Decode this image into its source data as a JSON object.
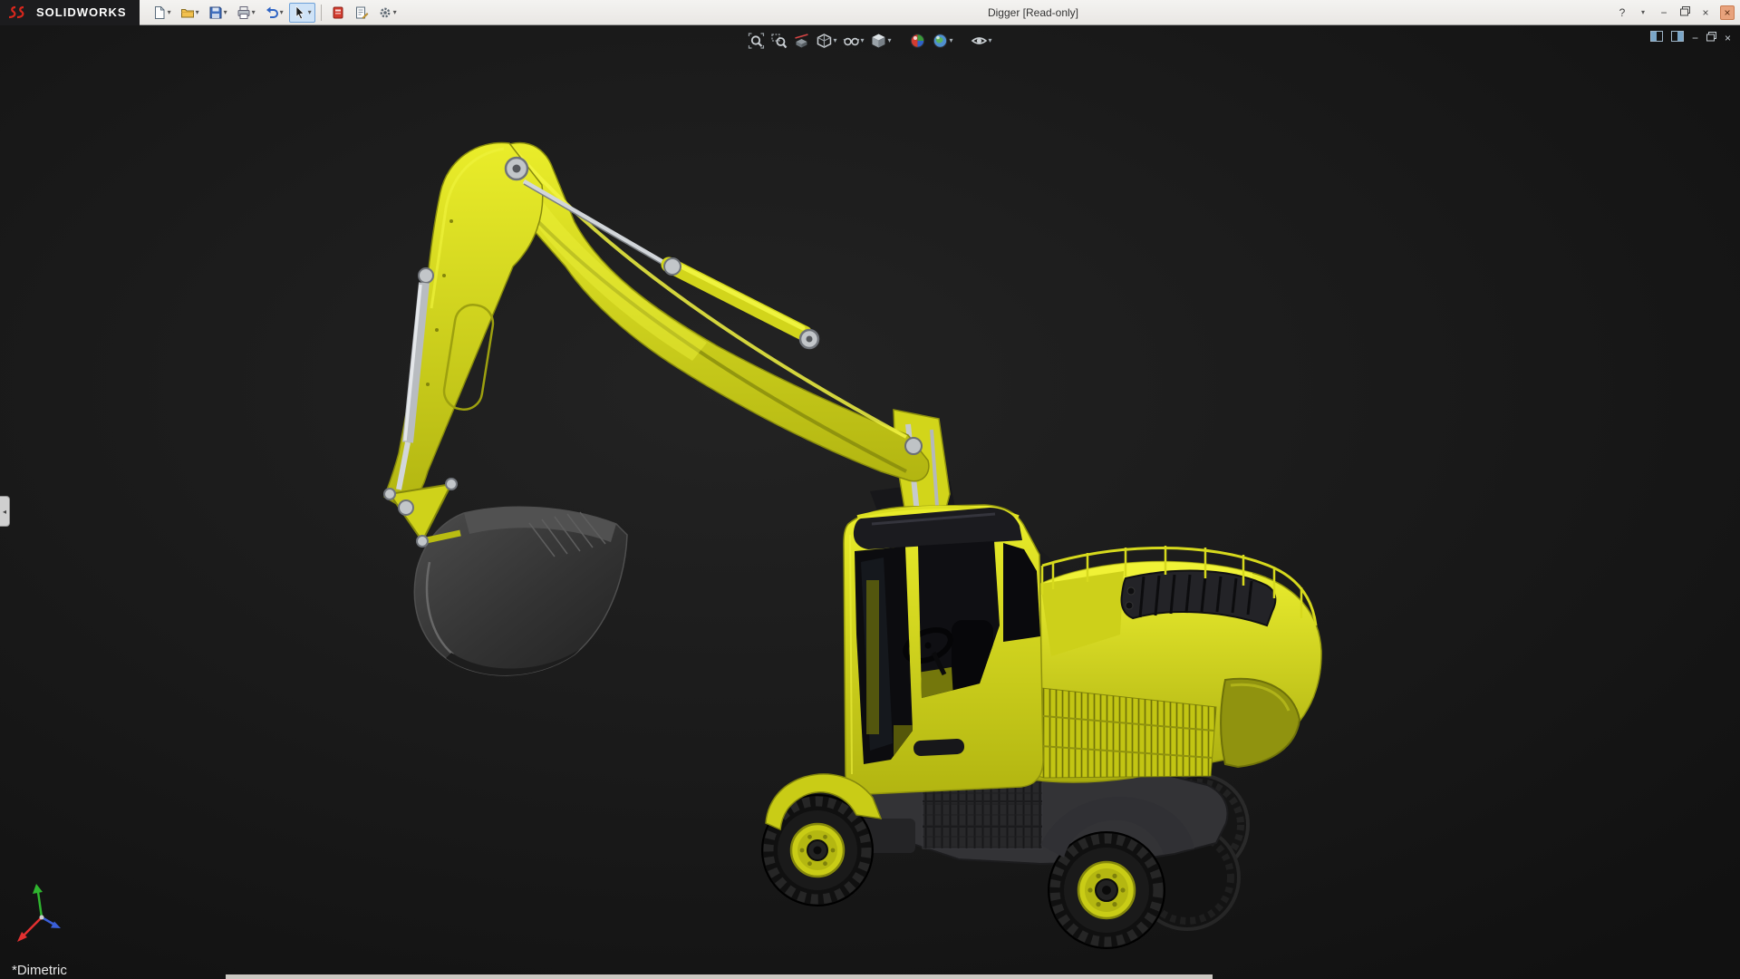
{
  "window": {
    "brand": "SOLIDWORKS",
    "title": "Digger [Read-only]"
  },
  "title_bar": {
    "tools": [
      {
        "name": "new",
        "dropdown": true
      },
      {
        "name": "open",
        "dropdown": true
      },
      {
        "name": "save",
        "dropdown": true
      },
      {
        "name": "print",
        "dropdown": true
      },
      {
        "name": "undo",
        "dropdown": true
      },
      {
        "name": "select",
        "dropdown": true,
        "active": true
      },
      {
        "name": "xpress-products",
        "dropdown": false
      },
      {
        "name": "file-properties",
        "dropdown": false
      },
      {
        "name": "options",
        "dropdown": true
      }
    ],
    "window_controls": [
      "help",
      "menu-caret",
      "minimize",
      "restore",
      "close",
      "app-close"
    ]
  },
  "headsup_toolbar": {
    "items": [
      {
        "name": "zoom-to-fit",
        "dropdown": false
      },
      {
        "name": "zoom-to-area",
        "dropdown": false
      },
      {
        "name": "section-view",
        "dropdown": false
      },
      {
        "name": "display-style",
        "dropdown": true
      },
      {
        "name": "hide-show-items",
        "dropdown": true
      },
      {
        "name": "view-orientation",
        "dropdown": true
      },
      {
        "name": "edit-appearance",
        "dropdown": false
      },
      {
        "name": "apply-scene",
        "dropdown": true
      },
      {
        "name": "view-settings",
        "dropdown": true
      }
    ]
  },
  "document_controls": [
    "pane-left",
    "pane-right",
    "minimize",
    "restore",
    "close"
  ],
  "viewport": {
    "orientation_label": "*Dimetric",
    "triad_axes": [
      {
        "axis": "x",
        "color": "#e23030"
      },
      {
        "axis": "y",
        "color": "#2fb52f"
      },
      {
        "axis": "z",
        "color": "#3a5fd9"
      }
    ]
  },
  "colors": {
    "titlebar_bg": "#e9e7e4",
    "viewport_bg": "#141414",
    "body_yellow": "#dfe21e",
    "body_yellow_dark": "#a9ac10",
    "metal_silver": "#c6cacd",
    "dark_part": "#2b2b2b"
  }
}
